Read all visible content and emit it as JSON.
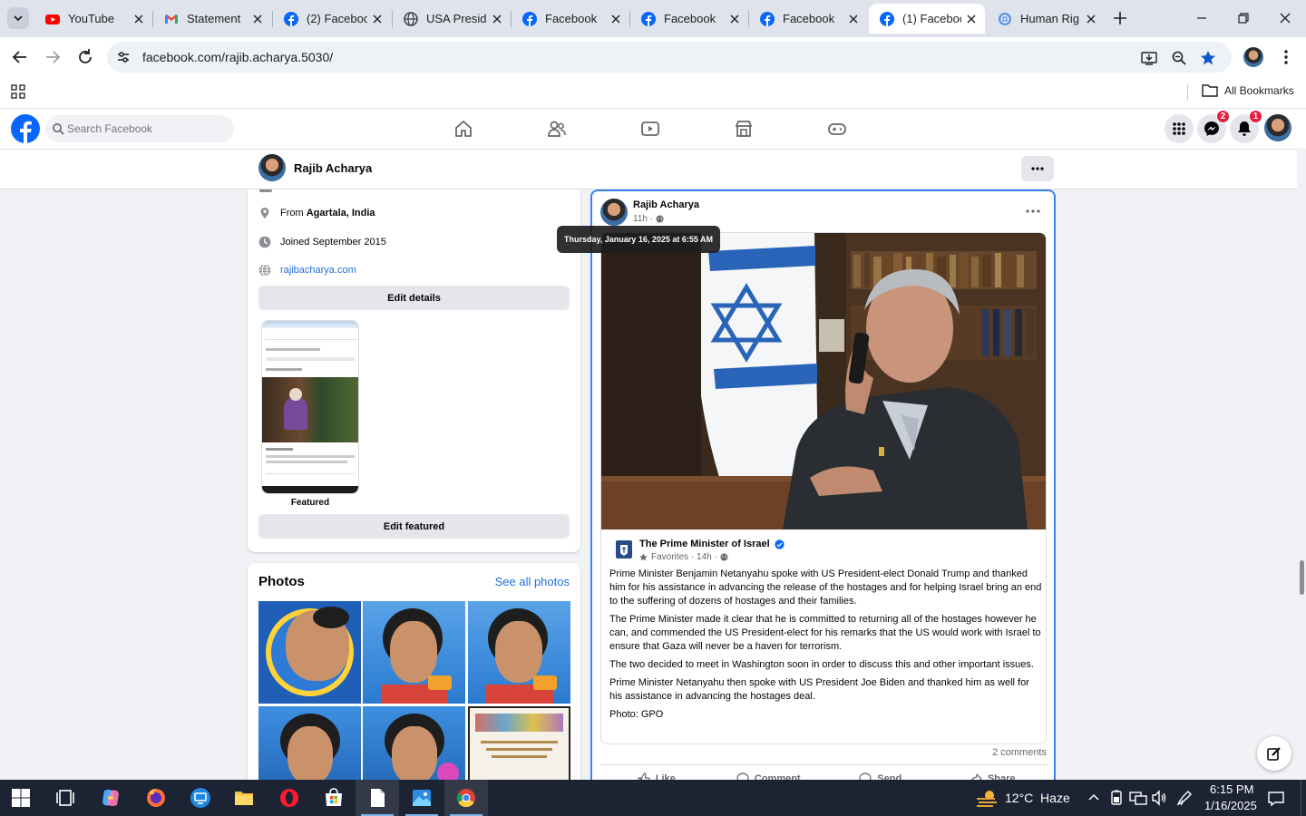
{
  "browser": {
    "tabs": [
      {
        "title": "YouTube",
        "icon": "youtube-icon"
      },
      {
        "title": "Statement",
        "icon": "gmail-icon"
      },
      {
        "title": "(2) Faceboo",
        "icon": "facebook-icon"
      },
      {
        "title": "USA Preside",
        "icon": "globe-icon"
      },
      {
        "title": "Facebook",
        "icon": "facebook-icon"
      },
      {
        "title": "Facebook",
        "icon": "facebook-icon"
      },
      {
        "title": "Facebook",
        "icon": "facebook-icon"
      },
      {
        "title": "(1) Faceboo",
        "icon": "facebook-icon",
        "active": true
      },
      {
        "title": "Human Rig",
        "icon": "un-icon"
      }
    ],
    "url": "facebook.com/rajib.acharya.5030/",
    "bookmarks_label": "All Bookmarks"
  },
  "facebook": {
    "search_placeholder": "Search Facebook",
    "messenger_badge": "2",
    "notifications_badge": "1",
    "brand_color": "#0866ff"
  },
  "profile": {
    "name": "Rajib Acharya",
    "from_prefix": "From ",
    "from_place": "Agartala, India",
    "joined": "Joined September 2015",
    "website": "rajibacharya.com",
    "edit_details": "Edit details",
    "featured_label": "Featured",
    "edit_featured": "Edit featured"
  },
  "photos": {
    "title": "Photos",
    "see_all": "See all photos"
  },
  "post": {
    "author": "Rajib Acharya",
    "time": "11h ·",
    "tooltip": "Thursday, January 16, 2025 at 6:55 AM",
    "shared_page": "The Prime Minister of Israel",
    "shared_meta": "Favorites · 14h ·",
    "paragraphs": [
      "Prime Minister Benjamin Netanyahu spoke with US President-elect Donald Trump and thanked him for his assistance in advancing the release of the hostages and for helping Israel bring an end to the suffering of dozens of hostages and their families.",
      "The Prime Minister made it clear that he is committed to returning all of the hostages however he can, and commended the US President-elect for his remarks that the US would work with Israel to ensure that Gaza will never be a haven for terrorism.",
      "The two decided to meet in Washington soon in order to discuss this and other important issues.",
      "Prime Minister Netanyahu then spoke with US President Joe Biden and thanked him as well for his assistance in advancing the hostages deal.",
      "Photo: GPO"
    ],
    "comments": "2 comments",
    "actions": {
      "like": "Like",
      "comment": "Comment",
      "send": "Send",
      "share": "Share"
    }
  },
  "taskbar": {
    "weather": "12°C  Haze",
    "time": "6:15 PM",
    "date": "1/16/2025"
  }
}
